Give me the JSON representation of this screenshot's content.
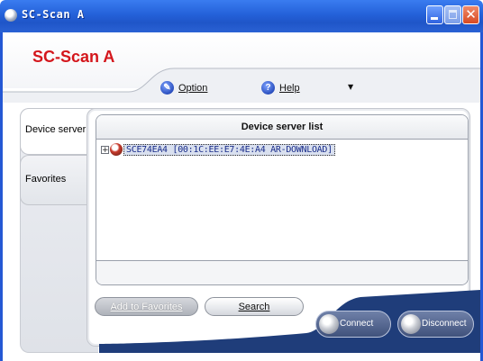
{
  "window": {
    "title": "SC-Scan A",
    "controls": {
      "minimize": "minimize",
      "maximize": "maximize",
      "close": "✕"
    }
  },
  "app": {
    "title": "SC-Scan A"
  },
  "menu": {
    "option": {
      "label": "Option",
      "icon": "option-icon"
    },
    "help": {
      "label": "Help",
      "icon": "help-icon",
      "glyph": "?"
    },
    "dropdown": "▼"
  },
  "tabs": [
    {
      "label": "Device server",
      "selected": true
    },
    {
      "label": "Favorites",
      "selected": false
    }
  ],
  "device_list": {
    "header": "Device server list",
    "items": [
      {
        "expander": "+",
        "icon": "device-server-icon",
        "label": "SCE74EA4 [00:1C:EE:E7:4E:A4 AR-DOWNLOAD]",
        "selected": true
      }
    ]
  },
  "buttons": {
    "add_to_favorites": "Add to Favorites",
    "search": "Search",
    "connect": "Connect",
    "disconnect": "Disconnect"
  },
  "colors": {
    "titlebar": "#2461d9",
    "app_title": "#d4161c",
    "bottom_band": "#1f3d7a"
  }
}
